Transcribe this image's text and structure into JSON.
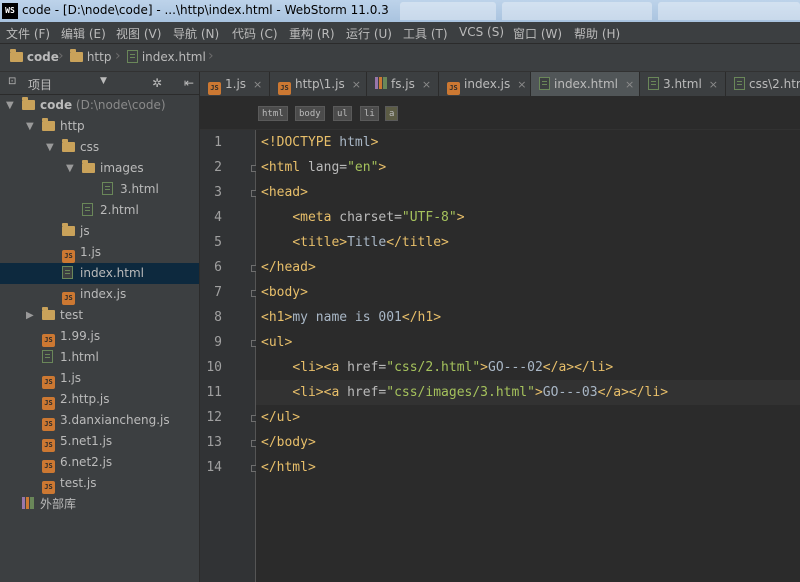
{
  "window": {
    "title": "code - [D:\\node\\code] - ...\\http\\index.html - WebStorm 11.0.3",
    "app_icon": "WS"
  },
  "menu": [
    "文件 (F)",
    "编辑 (E)",
    "视图 (V)",
    "导航 (N)",
    "代码 (C)",
    "重构 (R)",
    "运行 (U)",
    "工具 (T)",
    "VCS (S)",
    "窗口 (W)",
    "帮助 (H)"
  ],
  "breadcrumb": [
    "code",
    "http",
    "index.html"
  ],
  "project_panel": {
    "label": "项目",
    "dropdown_icon": "chevron-down-icon",
    "settings_icon": "gear-icon",
    "hide_icon": "collapse-icon"
  },
  "tree": [
    {
      "label": "code",
      "path": "(D:\\node\\code)",
      "type": "folder",
      "depth": 0,
      "expanded": true,
      "bold": true
    },
    {
      "label": "http",
      "type": "folder",
      "depth": 1,
      "expanded": true
    },
    {
      "label": "css",
      "type": "folder",
      "depth": 2,
      "expanded": true
    },
    {
      "label": "images",
      "type": "folder",
      "depth": 3,
      "expanded": true
    },
    {
      "label": "3.html",
      "type": "html",
      "depth": 4
    },
    {
      "label": "2.html",
      "type": "html",
      "depth": 3
    },
    {
      "label": "js",
      "type": "folder",
      "depth": 2,
      "expanded": false,
      "noarrow": true
    },
    {
      "label": "1.js",
      "type": "js",
      "depth": 2
    },
    {
      "label": "index.html",
      "type": "html",
      "depth": 2,
      "selected": true
    },
    {
      "label": "index.js",
      "type": "js",
      "depth": 2
    },
    {
      "label": "test",
      "type": "folder",
      "depth": 1,
      "expanded": false
    },
    {
      "label": "1.99.js",
      "type": "js",
      "depth": 1
    },
    {
      "label": "1.html",
      "type": "html",
      "depth": 1
    },
    {
      "label": "1.js",
      "type": "js",
      "depth": 1
    },
    {
      "label": "2.http.js",
      "type": "js",
      "depth": 1
    },
    {
      "label": "3.danxiancheng.js",
      "type": "js",
      "depth": 1
    },
    {
      "label": "5.net1.js",
      "type": "js",
      "depth": 1
    },
    {
      "label": "6.net2.js",
      "type": "js",
      "depth": 1
    },
    {
      "label": "test.js",
      "type": "js",
      "depth": 1
    },
    {
      "label": "外部库",
      "type": "lib",
      "depth": 0
    }
  ],
  "tabs": [
    {
      "label": "1.js",
      "type": "js",
      "active": false
    },
    {
      "label": "http\\1.js",
      "type": "js",
      "active": false
    },
    {
      "label": "fs.js",
      "type": "lib",
      "active": false
    },
    {
      "label": "index.js",
      "type": "js",
      "active": false
    },
    {
      "label": "index.html",
      "type": "html",
      "active": true
    },
    {
      "label": "3.html",
      "type": "html",
      "active": false
    },
    {
      "label": "css\\2.htm",
      "type": "html",
      "active": false
    }
  ],
  "tag_breadcrumb": [
    "html",
    "body",
    "ul",
    "li",
    "a"
  ],
  "code_lines": [
    {
      "n": "1",
      "fold": false,
      "tokens": [
        [
          "d",
          "<!DOCTYPE "
        ],
        [
          "x",
          "html"
        ],
        [
          "d",
          ">"
        ]
      ]
    },
    {
      "n": "2",
      "fold": true,
      "tokens": [
        [
          "t",
          "<html "
        ],
        [
          "a",
          "lang="
        ],
        [
          "v",
          "\"en\""
        ],
        [
          "t",
          ">"
        ]
      ]
    },
    {
      "n": "3",
      "fold": true,
      "tokens": [
        [
          "t",
          "<head>"
        ]
      ]
    },
    {
      "n": "4",
      "fold": false,
      "tokens": [
        [
          "x",
          "    "
        ],
        [
          "t",
          "<meta "
        ],
        [
          "a",
          "charset="
        ],
        [
          "v",
          "\"UTF-8\""
        ],
        [
          "t",
          ">"
        ]
      ]
    },
    {
      "n": "5",
      "fold": false,
      "tokens": [
        [
          "x",
          "    "
        ],
        [
          "t",
          "<title>"
        ],
        [
          "x",
          "Title"
        ],
        [
          "t",
          "</title>"
        ]
      ]
    },
    {
      "n": "6",
      "fold": true,
      "tokens": [
        [
          "t",
          "</head>"
        ]
      ]
    },
    {
      "n": "7",
      "fold": true,
      "tokens": [
        [
          "t",
          "<body>"
        ]
      ]
    },
    {
      "n": "8",
      "fold": false,
      "tokens": [
        [
          "t",
          "<h1>"
        ],
        [
          "x",
          "my name is 001"
        ],
        [
          "t",
          "</h1>"
        ]
      ]
    },
    {
      "n": "9",
      "fold": true,
      "tokens": [
        [
          "t",
          "<ul>"
        ]
      ]
    },
    {
      "n": "10",
      "fold": false,
      "tokens": [
        [
          "x",
          "    "
        ],
        [
          "t",
          "<li><a "
        ],
        [
          "a",
          "href="
        ],
        [
          "v",
          "\"css/2.html\""
        ],
        [
          "t",
          ">"
        ],
        [
          "x",
          "GO---02"
        ],
        [
          "t",
          "</a></li>"
        ]
      ]
    },
    {
      "n": "11",
      "fold": false,
      "current": true,
      "tokens": [
        [
          "x",
          "    "
        ],
        [
          "t",
          "<li><a "
        ],
        [
          "a",
          "href="
        ],
        [
          "v",
          "\"css/images/3.html\""
        ],
        [
          "t",
          ">"
        ],
        [
          "x",
          "GO---03"
        ],
        [
          "t",
          "</a></li>"
        ]
      ]
    },
    {
      "n": "12",
      "fold": true,
      "tokens": [
        [
          "t",
          "</ul>"
        ]
      ]
    },
    {
      "n": "13",
      "fold": true,
      "tokens": [
        [
          "t",
          "</body>"
        ]
      ]
    },
    {
      "n": "14",
      "fold": true,
      "tokens": [
        [
          "t",
          "</html>"
        ]
      ]
    }
  ],
  "colors": {
    "background": "#2b2b2b",
    "panel": "#3c3f41",
    "selection": "#0d293e",
    "tag": "#e8bf6a",
    "attr_value": "#a5c25c"
  }
}
